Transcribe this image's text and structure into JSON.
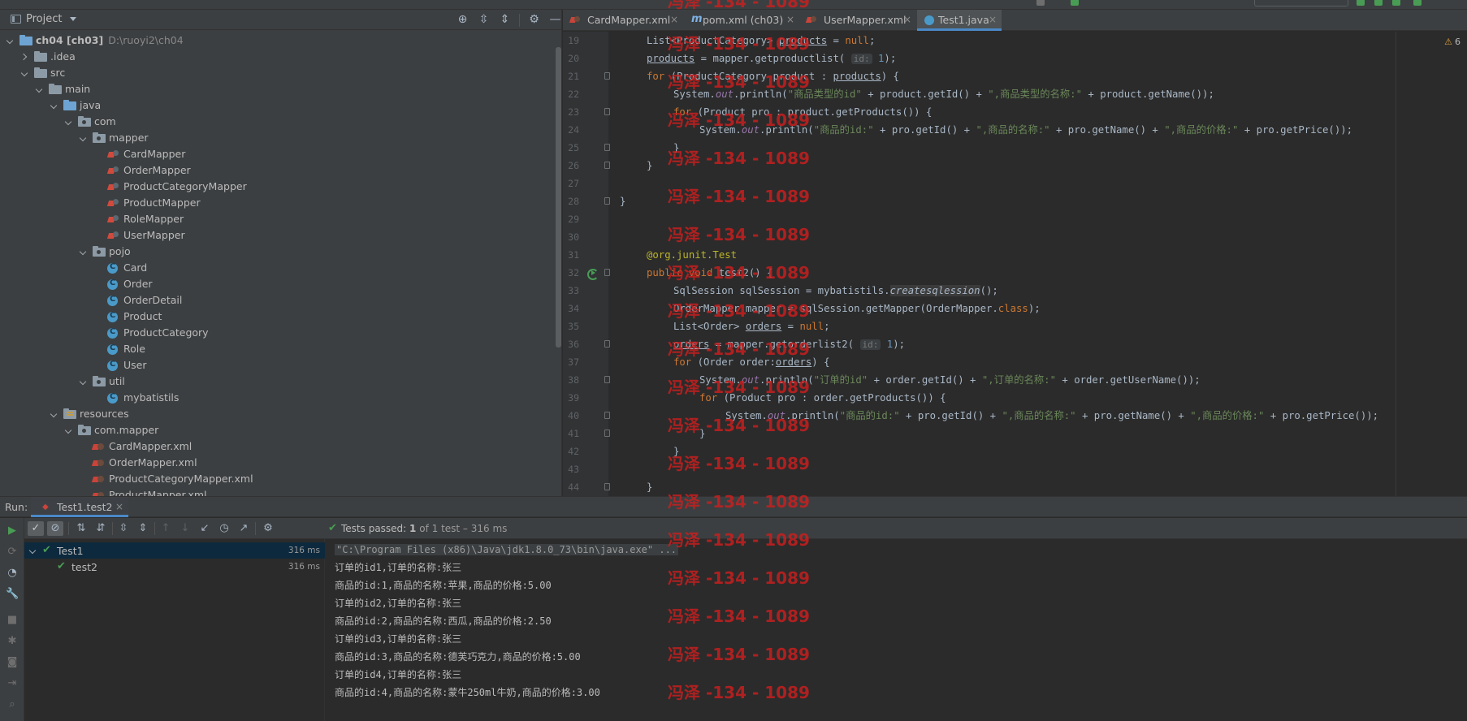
{
  "project_panel": {
    "title": "Project",
    "tree": [
      {
        "label": "ch04 [ch03]",
        "path": "D:\\ruoyi2\\ch04",
        "icon": "module-folder-icon",
        "state": "open"
      },
      {
        "label": ".idea",
        "icon": "folder-icon",
        "state": "closed"
      },
      {
        "label": "src",
        "icon": "folder-icon",
        "state": "open"
      },
      {
        "label": "main",
        "icon": "folder-icon",
        "state": "open"
      },
      {
        "label": "java",
        "icon": "source-folder-icon",
        "state": "open"
      },
      {
        "label": "com",
        "icon": "package-icon",
        "state": "open"
      },
      {
        "label": "mapper",
        "icon": "package-icon",
        "state": "open"
      },
      {
        "label": "CardMapper",
        "icon": "mybatis-mapper-icon"
      },
      {
        "label": "OrderMapper",
        "icon": "mybatis-mapper-icon"
      },
      {
        "label": "ProductCategoryMapper",
        "icon": "mybatis-mapper-icon"
      },
      {
        "label": "ProductMapper",
        "icon": "mybatis-mapper-icon"
      },
      {
        "label": "RoleMapper",
        "icon": "mybatis-mapper-icon"
      },
      {
        "label": "UserMapper",
        "icon": "mybatis-mapper-icon"
      },
      {
        "label": "pojo",
        "icon": "package-icon",
        "state": "open"
      },
      {
        "label": "Card",
        "icon": "class-icon"
      },
      {
        "label": "Order",
        "icon": "class-icon"
      },
      {
        "label": "OrderDetail",
        "icon": "class-icon"
      },
      {
        "label": "Product",
        "icon": "class-icon"
      },
      {
        "label": "ProductCategory",
        "icon": "class-icon"
      },
      {
        "label": "Role",
        "icon": "class-icon"
      },
      {
        "label": "User",
        "icon": "class-icon"
      },
      {
        "label": "util",
        "icon": "package-icon",
        "state": "open"
      },
      {
        "label": "mybatistils",
        "icon": "class-icon"
      },
      {
        "label": "resources",
        "icon": "resources-folder-icon",
        "state": "open"
      },
      {
        "label": "com.mapper",
        "icon": "package-icon",
        "state": "open"
      },
      {
        "label": "CardMapper.xml",
        "icon": "xml-file-icon"
      },
      {
        "label": "OrderMapper.xml",
        "icon": "xml-file-icon"
      },
      {
        "label": "ProductCategoryMapper.xml",
        "icon": "xml-file-icon"
      },
      {
        "label": "ProductMapper.xml",
        "icon": "xml-file-icon"
      }
    ]
  },
  "editor": {
    "tabs": [
      {
        "label": "CardMapper.xml",
        "icon": "xml-file-icon",
        "active": false
      },
      {
        "label": "pom.xml (ch03)",
        "icon": "maven-icon",
        "active": false
      },
      {
        "label": "UserMapper.xml",
        "icon": "xml-file-icon",
        "active": false
      },
      {
        "label": "Test1.java",
        "icon": "class-icon",
        "active": true
      }
    ],
    "warning_count": "6",
    "line_numbers": [
      "19",
      "20",
      "21",
      "22",
      "23",
      "24",
      "25",
      "26",
      "27",
      "28",
      "29",
      "30",
      "31",
      "32",
      "33",
      "34",
      "35",
      "36",
      "37",
      "38",
      "39",
      "40",
      "41",
      "42",
      "43",
      "44"
    ],
    "param_hint": "id:"
  },
  "watermark": "冯泽 -134 - 1089",
  "run_panel": {
    "label": "Run:",
    "tab_label": "Test1.test2",
    "status_prefix": "Tests passed:",
    "status_count": "1",
    "status_rest": "of 1 test – 316 ms",
    "tests": [
      {
        "name": "Test1",
        "time": "316 ms"
      },
      {
        "name": "test2",
        "time": "316 ms"
      }
    ],
    "console": [
      "\"C:\\Program Files (x86)\\Java\\jdk1.8.0_73\\bin\\java.exe\" ...",
      "订单的id1,订单的名称:张三",
      "商品的id:1,商品的名称:苹果,商品的价格:5.00",
      "订单的id2,订单的名称:张三",
      "商品的id:2,商品的名称:西瓜,商品的价格:2.50",
      "订单的id3,订单的名称:张三",
      "商品的id:3,商品的名称:德芙巧克力,商品的价格:5.00",
      "订单的id4,订单的名称:张三",
      "商品的id:4,商品的名称:蒙牛250ml牛奶,商品的价格:3.00"
    ]
  },
  "colors": {
    "keyword": "#cc7832",
    "string": "#6a8759",
    "number": "#6897bb",
    "static_field": "#9876aa",
    "annotation": "#bbb529",
    "pass_green": "#499c54",
    "tab_underline": "#4a88c7",
    "watermark_red": "#cd1e1e"
  }
}
